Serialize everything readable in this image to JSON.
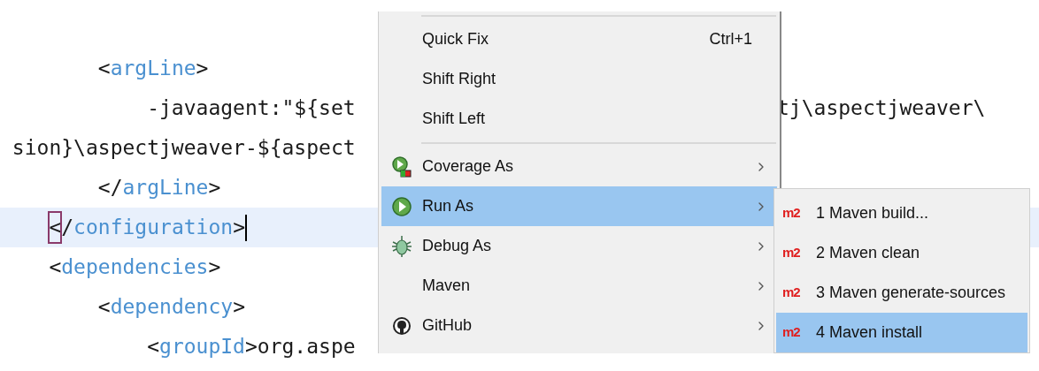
{
  "editor": {
    "lines": [
      {
        "current": false,
        "tokens": [
          {
            "kind": "bracket",
            "text": "        <"
          },
          {
            "kind": "tag",
            "text": "argLine"
          },
          {
            "kind": "bracket",
            "text": ">"
          }
        ]
      },
      {
        "current": false,
        "tokens": [
          {
            "kind": "text",
            "text": "            -javaagent:\"${set"
          }
        ],
        "continued": "tj\\aspectjweaver\\"
      },
      {
        "current": false,
        "tokens": [
          {
            "kind": "text",
            "text": " sion}\\aspectjweaver-${aspect"
          }
        ]
      },
      {
        "current": false,
        "tokens": [
          {
            "kind": "bracket",
            "text": "        </"
          },
          {
            "kind": "tag",
            "text": "argLine"
          },
          {
            "kind": "bracket",
            "text": ">"
          }
        ]
      },
      {
        "current": true,
        "tokens": [
          {
            "kind": "bracket",
            "text": "    <",
            "match": true
          },
          {
            "kind": "bracket",
            "text": "/"
          },
          {
            "kind": "tag",
            "text": "configuration"
          },
          {
            "kind": "bracket",
            "text": ">"
          }
        ],
        "cursor": true
      },
      {
        "current": false,
        "tokens": [
          {
            "kind": "bracket",
            "text": "    <"
          },
          {
            "kind": "tag",
            "text": "dependencies"
          },
          {
            "kind": "bracket",
            "text": ">"
          }
        ]
      },
      {
        "current": false,
        "tokens": [
          {
            "kind": "bracket",
            "text": "        <"
          },
          {
            "kind": "tag",
            "text": "dependency"
          },
          {
            "kind": "bracket",
            "text": ">"
          }
        ]
      },
      {
        "current": false,
        "tokens": [
          {
            "kind": "bracket",
            "text": "            <"
          },
          {
            "kind": "tag",
            "text": "groupId"
          },
          {
            "kind": "bracket",
            "text": ">"
          },
          {
            "kind": "text",
            "text": "org.aspe"
          }
        ]
      }
    ]
  },
  "context_menu": {
    "items": [
      {
        "kind": "separator"
      },
      {
        "kind": "item",
        "label": "Quick Fix",
        "shortcut": "Ctrl+1",
        "submenu": false,
        "selected": false
      },
      {
        "kind": "item",
        "label": "Shift Right",
        "submenu": false,
        "selected": false
      },
      {
        "kind": "item",
        "label": "Shift Left",
        "submenu": false,
        "selected": false
      },
      {
        "kind": "separator"
      },
      {
        "kind": "item",
        "label": "Coverage As",
        "submenu": true,
        "selected": false
      },
      {
        "kind": "item",
        "label": "Run As",
        "submenu": true,
        "selected": true
      },
      {
        "kind": "item",
        "label": "Debug As",
        "submenu": true,
        "selected": false
      },
      {
        "kind": "item",
        "label": "Maven",
        "submenu": true,
        "selected": false
      },
      {
        "kind": "item",
        "label": "GitHub",
        "submenu": true,
        "selected": false
      }
    ]
  },
  "submenu": {
    "items": [
      {
        "icon_text": "m2",
        "label": "1 Maven build...",
        "selected": false
      },
      {
        "icon_text": "m2",
        "label": "2 Maven clean",
        "selected": false
      },
      {
        "icon_text": "m2",
        "label": "3 Maven generate-sources",
        "selected": false
      },
      {
        "icon_text": "m2",
        "label": "4 Maven install",
        "selected": true
      }
    ]
  }
}
